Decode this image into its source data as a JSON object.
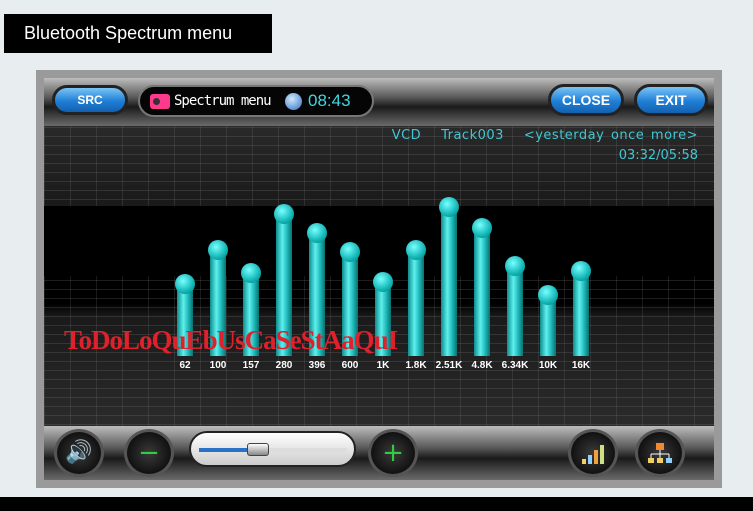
{
  "page_title": "Bluetooth Spectrum menu",
  "topbar": {
    "src_label": "SRC",
    "menu_label": "Spectrum menu",
    "clock": "08:43",
    "close_label": "CLOSE",
    "exit_label": "EXIT"
  },
  "now_playing": {
    "source": "VCD",
    "track": "Track003",
    "title": "<yesterday once more>",
    "time": "03:32/05:58"
  },
  "overlay_text": "ToDoLoQuEbUsCaSeStAaQuI",
  "spectrum": {
    "color": "#1fc8c8",
    "bands": [
      {
        "label": "62",
        "level": 45
      },
      {
        "label": "100",
        "level": 66
      },
      {
        "label": "157",
        "level": 52
      },
      {
        "label": "280",
        "level": 89
      },
      {
        "label": "396",
        "level": 77
      },
      {
        "label": "600",
        "level": 65
      },
      {
        "label": "1K",
        "level": 46
      },
      {
        "label": "1.8K",
        "level": 66
      },
      {
        "label": "2.51K",
        "level": 93
      },
      {
        "label": "4.8K",
        "level": 80
      },
      {
        "label": "6.34K",
        "level": 56
      },
      {
        "label": "10K",
        "level": 38
      },
      {
        "label": "16K",
        "level": 53
      }
    ]
  },
  "bottombar": {
    "volume_icon": "speaker-icon",
    "minus": "−",
    "plus": "+",
    "slider_percent": 40,
    "eq_icon": "signal-bars-icon",
    "net_icon": "network-icon"
  },
  "colors": {
    "accent_text": "#3fd7e0",
    "overlay": "#e0202a",
    "button_blue": "#1e7fd6"
  }
}
